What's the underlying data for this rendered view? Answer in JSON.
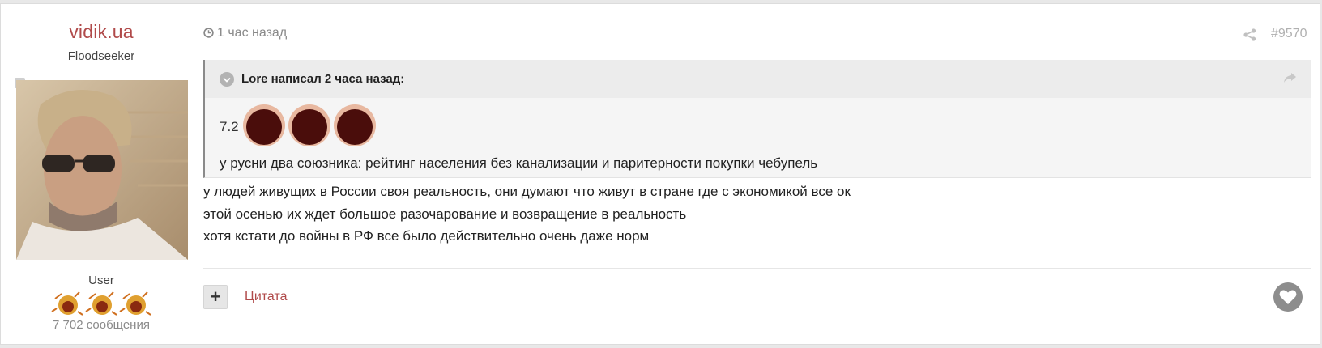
{
  "author": {
    "name": "vidik.ua",
    "title": "Floodseeker",
    "group": "User",
    "post_count": "7 702 сообщения",
    "rank_icon": "flame-rank-icon"
  },
  "post": {
    "time": "1 час назад",
    "number": "#9570",
    "quote": {
      "citation": "Lore написал 2 часа назад:",
      "prefix": "7.2",
      "text": "у русни два союзника: рейтинг населения без канализации и паритерности покупки чебупель"
    },
    "lines": [
      "у людей живущих в России своя реальность, они думают что живут в стране где с экономикой все ок",
      "этой осенью их ждет большое разочарование и возвращение в реальность",
      "хотя кстати до войны в РФ все было действительно очень даже норм"
    ]
  },
  "actions": {
    "multiquote_label": "+",
    "quote_label": "Цитата"
  },
  "colors": {
    "accent": "#b04a4a",
    "muted": "#8a8a8a"
  }
}
